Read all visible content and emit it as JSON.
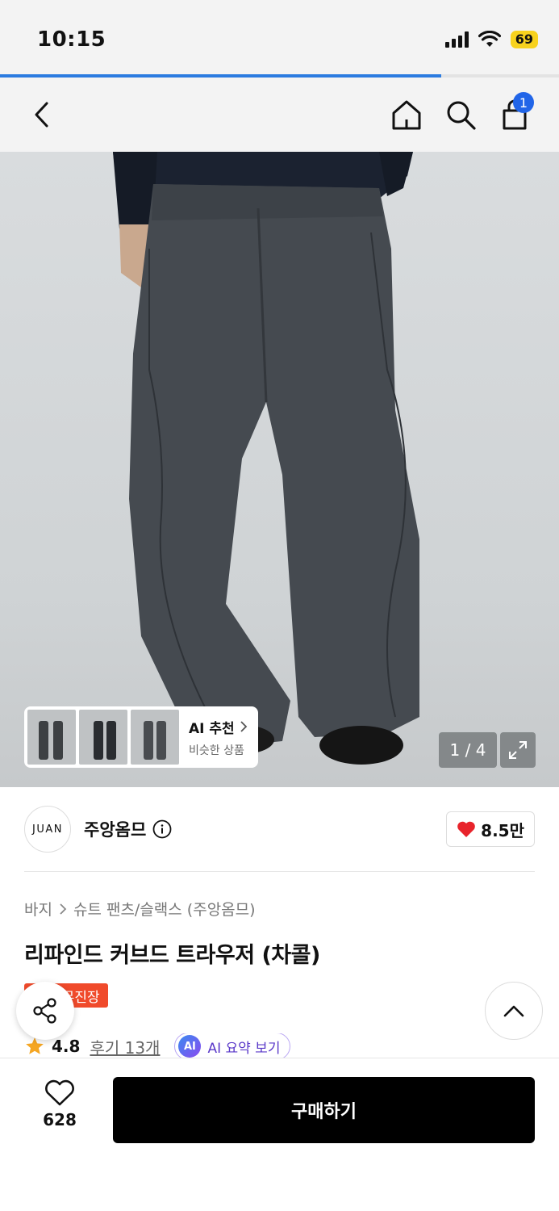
{
  "status_bar": {
    "time": "10:15",
    "battery": "69"
  },
  "page_progress": 0.79,
  "nav": {
    "cart_count": "1"
  },
  "gallery": {
    "ai_recommend_title": "AI 추천",
    "ai_recommend_subtitle": "비슷한 상품",
    "counter": "1 / 4"
  },
  "brand": {
    "logo_text": "JUAN",
    "name": "주앙옴므",
    "likes": "8.5만"
  },
  "breadcrumb": {
    "category": "바지",
    "subcategory": "슈트 팬츠/슬랙스 (주앙옴므)"
  },
  "product": {
    "title": "리파인드 커브드 트라우저 (차콜)",
    "tag": "단독 무진장"
  },
  "rating": {
    "value": "4.8",
    "reviews": "후기 13개",
    "ai_summary": "AI 요약 보기",
    "ai_badge": "AI"
  },
  "bottom": {
    "wish_count": "628",
    "buy_label": "구매하기"
  },
  "colors": {
    "accent_blue": "#2165e8",
    "tag_red": "#f04a2b",
    "heart_red": "#e8232b",
    "star": "#f5a623",
    "ai_purple": "#5a39c9"
  }
}
